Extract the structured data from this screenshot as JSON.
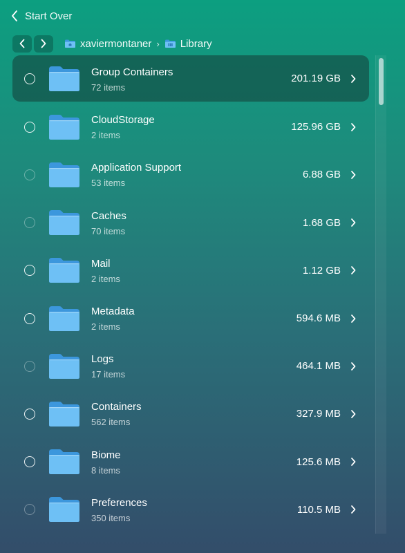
{
  "header": {
    "back_label": "Start Over"
  },
  "breadcrumb": {
    "items": [
      {
        "label": "xaviermontaner"
      },
      {
        "label": "Library"
      }
    ]
  },
  "folders": [
    {
      "name": "Group Containers",
      "items": "72 items",
      "size": "201.19 GB",
      "selected": true,
      "radio_dim": false
    },
    {
      "name": "CloudStorage",
      "items": "2 items",
      "size": "125.96 GB",
      "selected": false,
      "radio_dim": false
    },
    {
      "name": "Application Support",
      "items": "53 items",
      "size": "6.88 GB",
      "selected": false,
      "radio_dim": true
    },
    {
      "name": "Caches",
      "items": "70 items",
      "size": "1.68 GB",
      "selected": false,
      "radio_dim": true
    },
    {
      "name": "Mail",
      "items": "2 items",
      "size": "1.12 GB",
      "selected": false,
      "radio_dim": false
    },
    {
      "name": "Metadata",
      "items": "2 items",
      "size": "594.6 MB",
      "selected": false,
      "radio_dim": false
    },
    {
      "name": "Logs",
      "items": "17 items",
      "size": "464.1 MB",
      "selected": false,
      "radio_dim": true
    },
    {
      "name": "Containers",
      "items": "562 items",
      "size": "327.9 MB",
      "selected": false,
      "radio_dim": false
    },
    {
      "name": "Biome",
      "items": "8 items",
      "size": "125.6 MB",
      "selected": false,
      "radio_dim": false
    },
    {
      "name": "Preferences",
      "items": "350 items",
      "size": "110.5 MB",
      "selected": false,
      "radio_dim": true
    }
  ],
  "colors": {
    "folder_body": "#6ec0f5",
    "folder_tab": "#3c97dd",
    "selected_row": "#1c4a45"
  }
}
